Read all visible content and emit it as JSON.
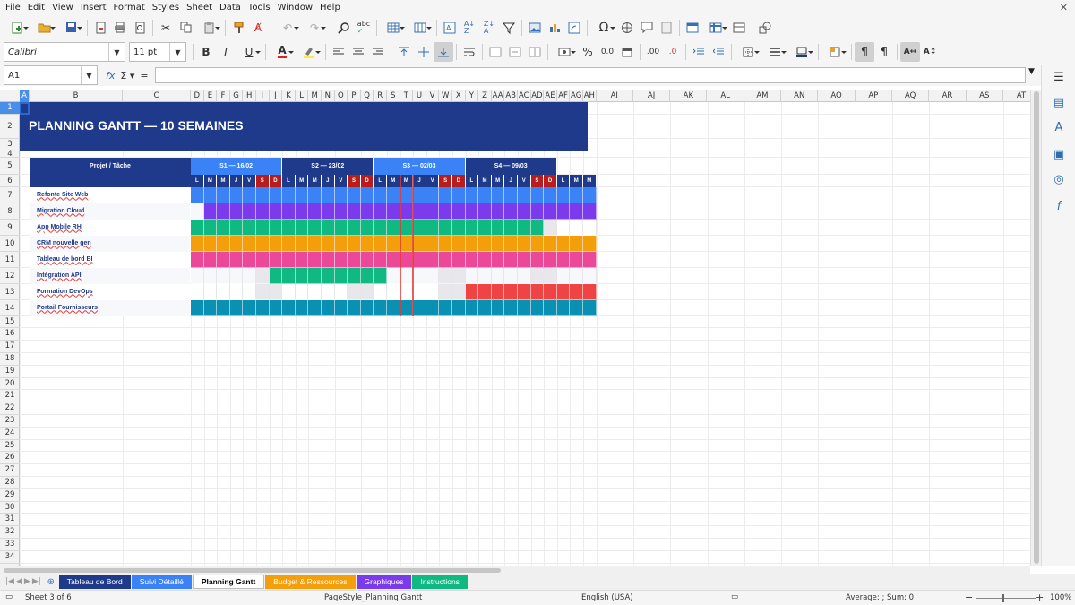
{
  "menu": [
    "File",
    "Edit",
    "View",
    "Insert",
    "Format",
    "Styles",
    "Sheet",
    "Data",
    "Tools",
    "Window",
    "Help"
  ],
  "toolbar": {
    "font_name": "Calibri",
    "font_size": "11 pt",
    "bold": "B",
    "italic": "I",
    "underline": "U",
    "percent": "%",
    "decimals": "0.0",
    "add_decimal": ".00",
    "remove_decimal": ".0"
  },
  "formula_bar": {
    "cell_ref": "A1",
    "value": ""
  },
  "sheet": {
    "columns": [
      "A",
      "B",
      "C",
      "D",
      "E",
      "F",
      "G",
      "H",
      "I",
      "J",
      "K",
      "L",
      "M",
      "N",
      "O",
      "P",
      "Q",
      "R",
      "S",
      "T",
      "U",
      "V",
      "W",
      "X",
      "Y",
      "Z",
      "AA",
      "AB",
      "AC",
      "AD",
      "AE",
      "AF",
      "AG",
      "AH",
      "AI",
      "AJ",
      "AK",
      "AL",
      "AM",
      "AN",
      "AO",
      "AP",
      "AQ",
      "AR",
      "AS",
      "AT"
    ],
    "rows": [
      "1",
      "2",
      "3",
      "4",
      "5",
      "6",
      "7",
      "8",
      "9",
      "10",
      "11",
      "12",
      "13",
      "14",
      "15",
      "16",
      "17",
      "18",
      "19",
      "20",
      "21",
      "22",
      "23",
      "24",
      "25",
      "26",
      "27",
      "28",
      "29",
      "30",
      "31",
      "32",
      "33",
      "34"
    ],
    "title": "PLANNING GANTT — 10 SEMAINES",
    "header_label": "Projet / Tâche",
    "weeks": [
      "S1 — 16/02",
      "S2 — 23/02",
      "S3 — 02/03",
      "S4 — 09/03"
    ],
    "days": [
      "L",
      "M",
      "M",
      "J",
      "V",
      "S",
      "D",
      "L",
      "M",
      "M",
      "J",
      "V",
      "S",
      "D",
      "L",
      "M",
      "M",
      "J",
      "V",
      "S",
      "D",
      "L",
      "M",
      "M",
      "J",
      "V",
      "S",
      "D",
      "L",
      "M",
      "M"
    ],
    "tasks": [
      {
        "name": "Refonte Site Web",
        "color": "#3b82f6",
        "start": 0,
        "end": 30
      },
      {
        "name": "Migration Cloud",
        "color": "#7c3aed",
        "start": 1,
        "end": 30
      },
      {
        "name": "App Mobile RH",
        "color": "#10b981",
        "start": 0,
        "end": 26
      },
      {
        "name": "CRM nouvelle gen",
        "color": "#f59e0b",
        "start": 0,
        "end": 30
      },
      {
        "name": "Tableau de bord BI",
        "color": "#ec4899",
        "start": 0,
        "end": 30
      },
      {
        "name": "Intégration API",
        "color": "#10b981",
        "start": 6,
        "end": 14
      },
      {
        "name": "Formation DevOps",
        "color": "#ef4444",
        "start": 21,
        "end": 30
      },
      {
        "name": "Portail Fournisseurs",
        "color": "#0891b2",
        "start": 0,
        "end": 30
      }
    ]
  },
  "sheet_tabs": [
    {
      "label": "Tableau de Bord",
      "color": "#1f3a8a"
    },
    {
      "label": "Suivi Détaillé",
      "color": "#3b82f6"
    },
    {
      "label": "Planning Gantt",
      "color": "#ffffff"
    },
    {
      "label": "Budget & Ressources",
      "color": "#f59e0b"
    },
    {
      "label": "Graphiques",
      "color": "#7c3aed"
    },
    {
      "label": "Instructions",
      "color": "#10b981"
    }
  ],
  "status": {
    "sheet_info": "Sheet 3 of 6",
    "page_style": "PageStyle_Planning Gantt",
    "language": "English (USA)",
    "summary": "Average: ; Sum: 0",
    "zoom": "100%",
    "zoom_minus": "−",
    "zoom_plus": "+"
  },
  "colors": {
    "title_bg": "#1f3a8a",
    "header_bg": "#1f3a8a",
    "week_alt": "#3b82f6",
    "weekend": "#b91c1c",
    "selection": "#4a8ee8"
  }
}
